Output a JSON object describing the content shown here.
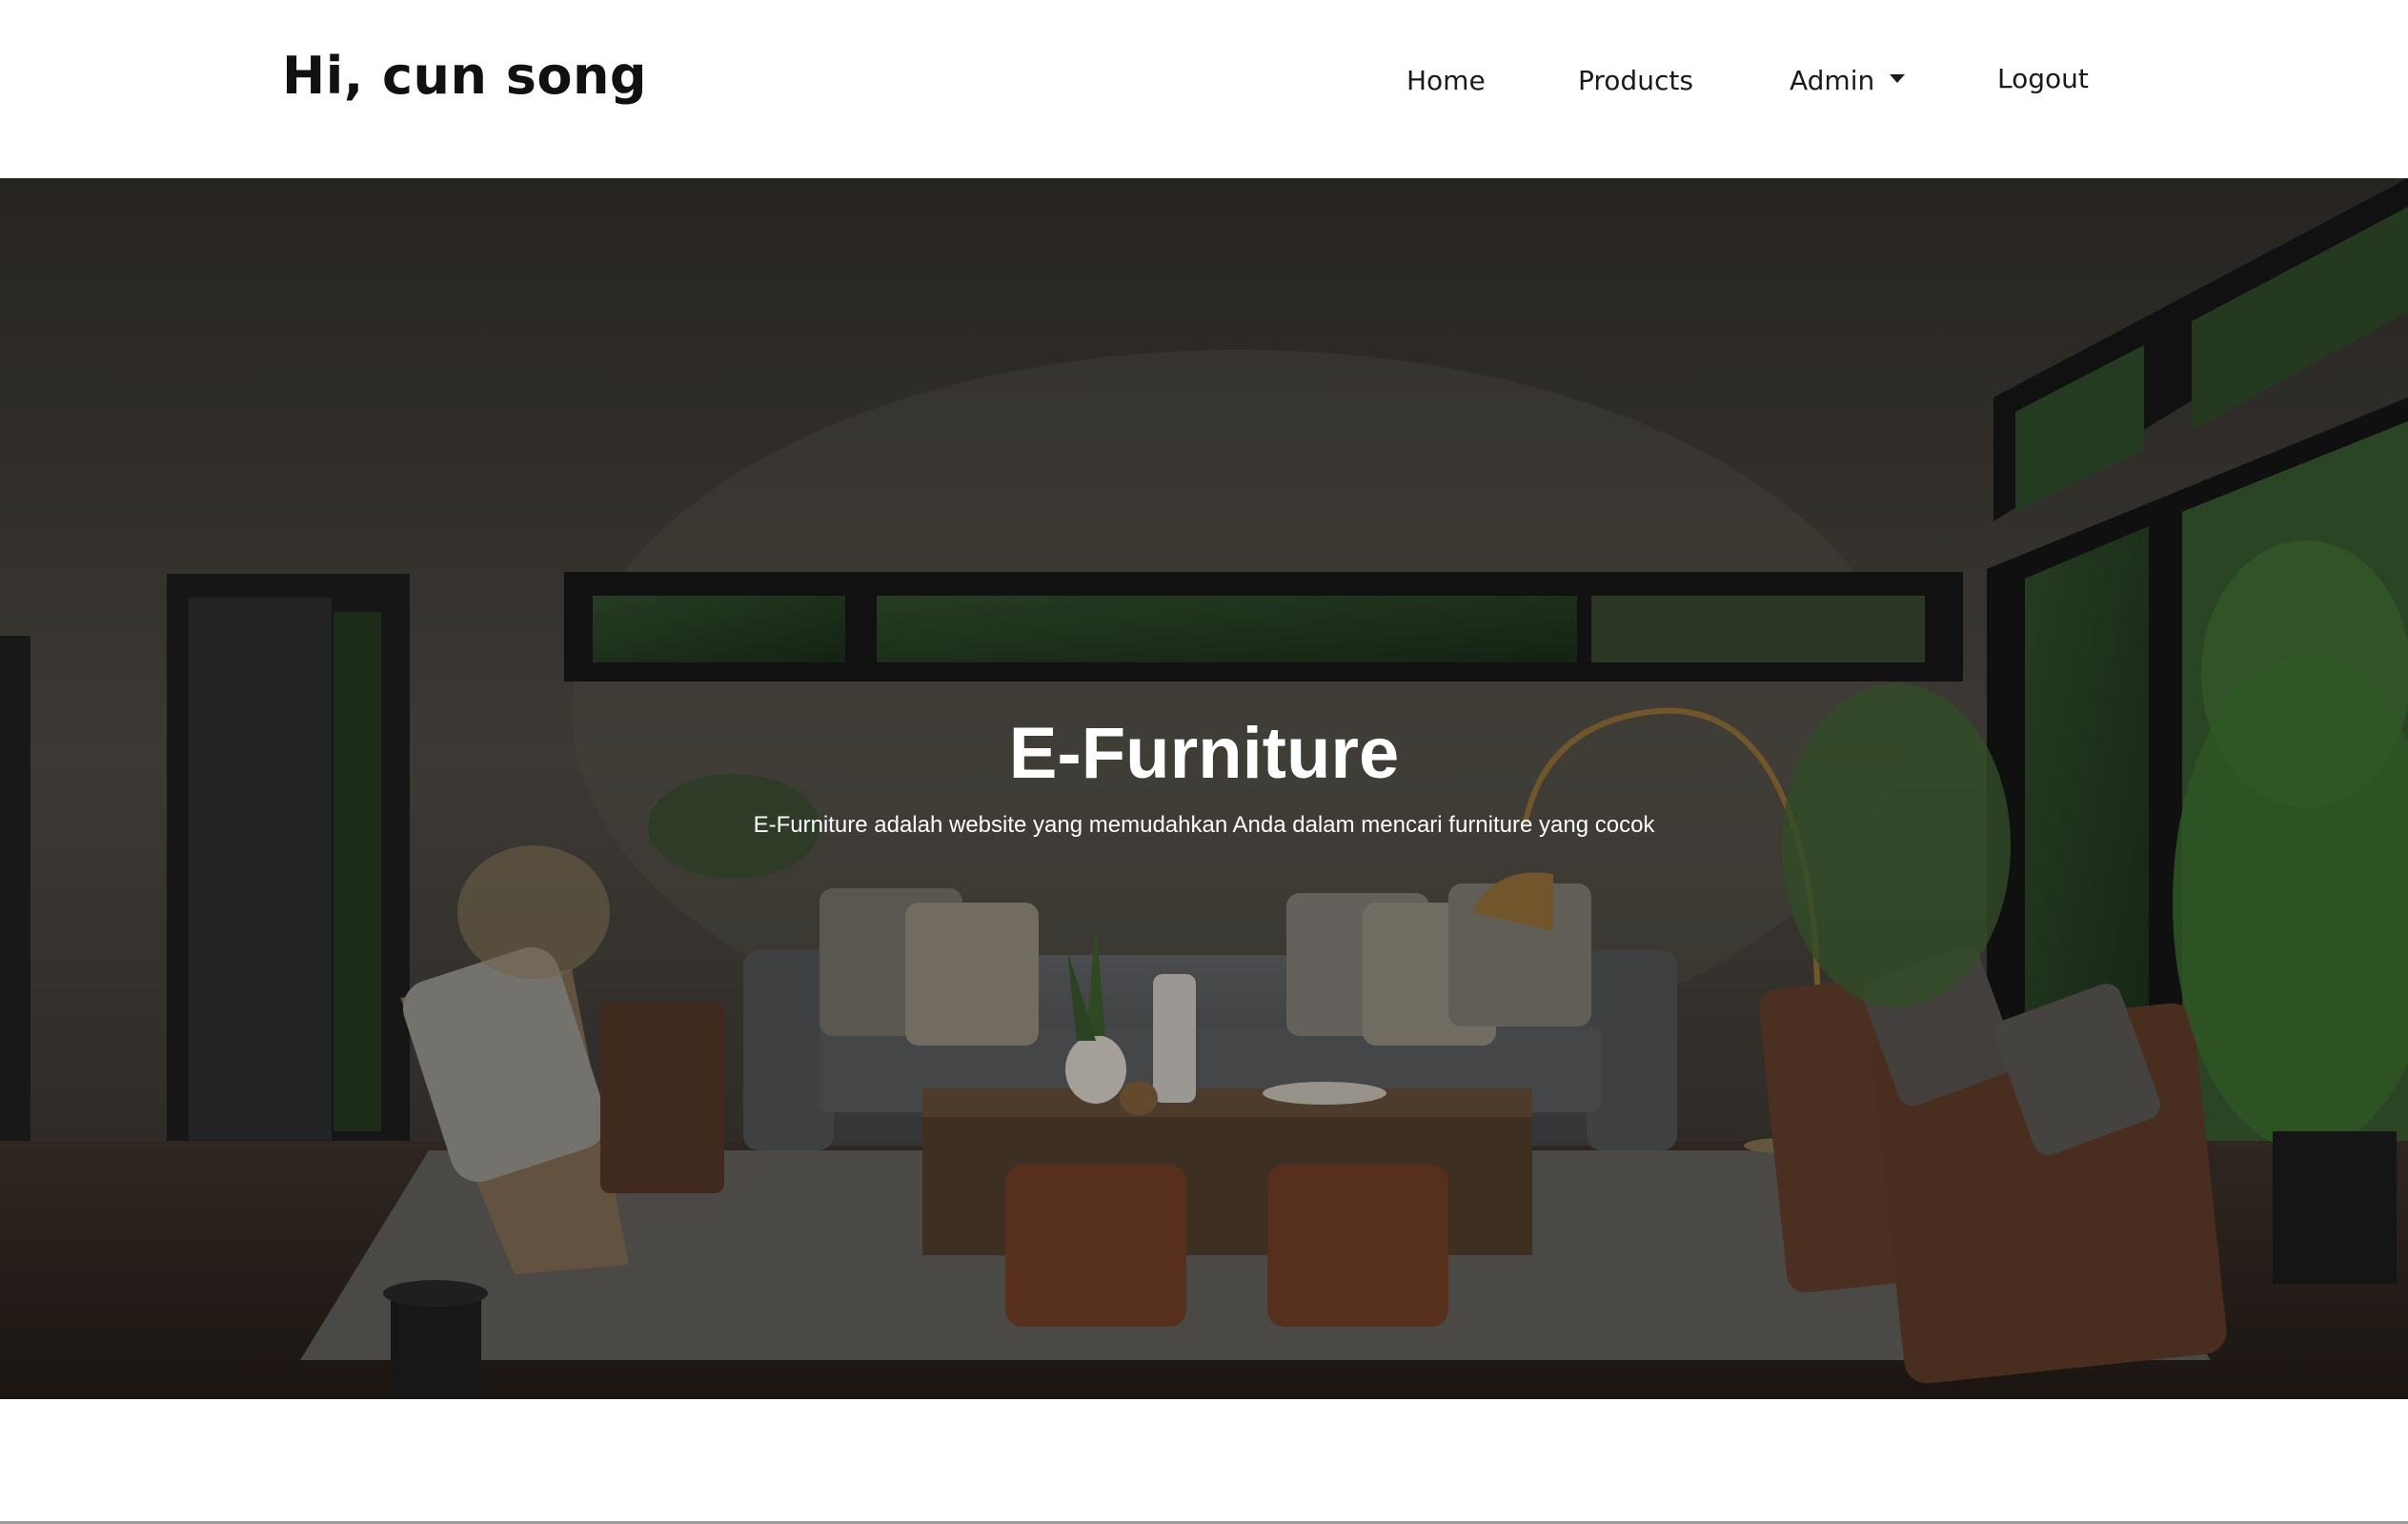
{
  "navbar": {
    "brand": "Hi, cun song",
    "links": [
      {
        "label": "Home"
      },
      {
        "label": "Products"
      },
      {
        "label": "Admin"
      },
      {
        "label": "Logout"
      }
    ]
  },
  "hero": {
    "title": "E-Furniture",
    "subtitle": "E-Furniture adalah website yang memudahkan Anda dalam mencari furniture yang cocok"
  }
}
